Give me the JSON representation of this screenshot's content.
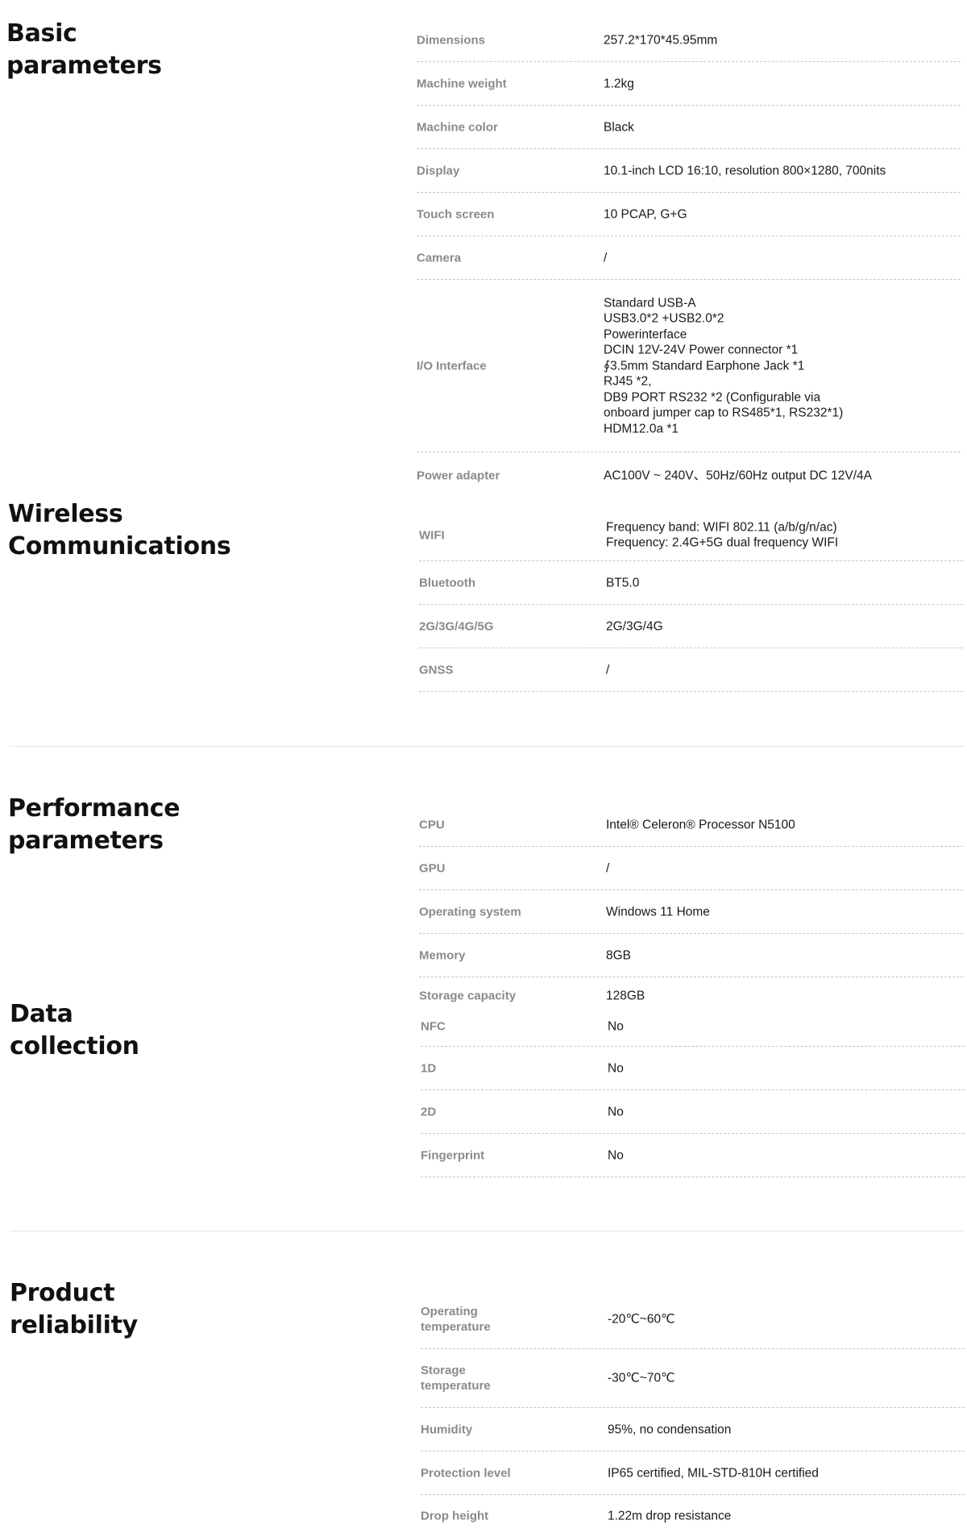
{
  "sections": {
    "basic": {
      "title": [
        "Basic",
        "parameters"
      ],
      "rows": [
        {
          "label": "Dimensions",
          "value": "257.2*170*45.95mm"
        },
        {
          "label": "Machine weight",
          "value": "1.2kg"
        },
        {
          "label": "Machine color",
          "value": "Black"
        },
        {
          "label": "Display",
          "value": "10.1-inch LCD 16:10, resolution 800×1280, 700nits"
        },
        {
          "label": "Touch screen",
          "value": "10 PCAP, G+G"
        },
        {
          "label": "Camera",
          "value": "/"
        },
        {
          "label": "I/O Interface",
          "value": "Standard USB-A\nUSB3.0*2 +USB2.0*2\nPowerinterface\nDCIN 12V-24V Power connector *1\n∮3.5mm Standard Earphone Jack *1\nRJ45 *2,\nDB9 PORT RS232 *2 (Configurable via\nonboard jumper cap to RS485*1, RS232*1)\nHDM12.0a *1"
        },
        {
          "label": "Power adapter",
          "value": "AC100V ~ 240V、50Hz/60Hz output DC 12V/4A"
        }
      ]
    },
    "wireless": {
      "title": [
        "Wireless",
        "Communications"
      ],
      "rows": [
        {
          "label": "WIFI",
          "value": "Frequency band: WIFI 802.11 (a/b/g/n/ac)\nFrequency: 2.4G+5G dual frequency WIFI"
        },
        {
          "label": "Bluetooth",
          "value": "BT5.0"
        },
        {
          "label": "2G/3G/4G/5G",
          "value": "2G/3G/4G"
        },
        {
          "label": "GNSS",
          "value": "/"
        }
      ]
    },
    "performance": {
      "title": [
        "Performance",
        "parameters"
      ],
      "rows": [
        {
          "label": "CPU",
          "value": "Intel® Celeron® Processor N5100"
        },
        {
          "label": "GPU",
          "value": "/"
        },
        {
          "label": "Operating system",
          "value": "Windows 11 Home"
        },
        {
          "label": "Memory",
          "value": "8GB"
        },
        {
          "label": "Storage capacity",
          "value": "128GB"
        }
      ]
    },
    "data": {
      "title": [
        "Data",
        "collection"
      ],
      "rows": [
        {
          "label": "NFC",
          "value": "No"
        },
        {
          "label": "1D",
          "value": "No"
        },
        {
          "label": "2D",
          "value": "No"
        },
        {
          "label": "Fingerprint",
          "value": "No"
        }
      ]
    },
    "reliability": {
      "title": [
        "Product",
        "reliability"
      ],
      "rows": [
        {
          "label": "Operating\ntemperature",
          "value": "-20℃~60℃"
        },
        {
          "label": "Storage\ntemperature",
          "value": "-30℃~70℃"
        },
        {
          "label": "Humidity",
          "value": "95%, no condensation"
        },
        {
          "label": "Protection level",
          "value": "IP65 certified, MIL-STD-810H certified"
        },
        {
          "label": "Drop height",
          "value": "1.22m drop resistance"
        }
      ]
    }
  }
}
